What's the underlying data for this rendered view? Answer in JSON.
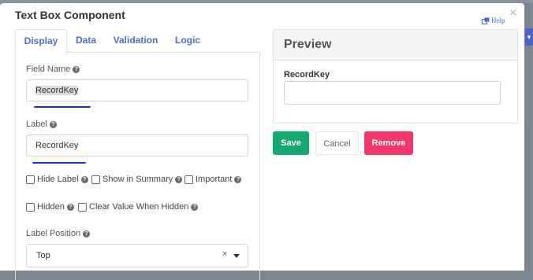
{
  "dialog": {
    "title": "Text Box Component",
    "help_label": "Help",
    "close_symbol": "×"
  },
  "tabs": [
    {
      "label": "Display",
      "active": true
    },
    {
      "label": "Data",
      "active": false
    },
    {
      "label": "Validation",
      "active": false
    },
    {
      "label": "Logic",
      "active": false
    }
  ],
  "form": {
    "field_name": {
      "label": "Field Name",
      "value": "RecordKey"
    },
    "label_field": {
      "label": "Label",
      "value": "RecordKey"
    },
    "checkboxes": [
      {
        "label": "Hide Label",
        "checked": false
      },
      {
        "label": "Show in Summary",
        "checked": false
      },
      {
        "label": "Important",
        "checked": false
      },
      {
        "label": "Hidden",
        "checked": false
      },
      {
        "label": "Clear Value When Hidden",
        "checked": false
      }
    ],
    "label_position": {
      "label": "Label Position",
      "value": "Top",
      "clear_symbol": "×"
    }
  },
  "preview": {
    "title": "Preview",
    "field_label": "RecordKey",
    "field_value": ""
  },
  "buttons": {
    "save": "Save",
    "cancel": "Cancel",
    "remove": "Remove"
  },
  "colors": {
    "accent_blue": "#4a6fd2",
    "save_green": "#13a970",
    "remove_pink": "#f3376d",
    "underline_blue": "#1c33c8"
  },
  "background": {
    "side_tab_glyph": "▾"
  }
}
